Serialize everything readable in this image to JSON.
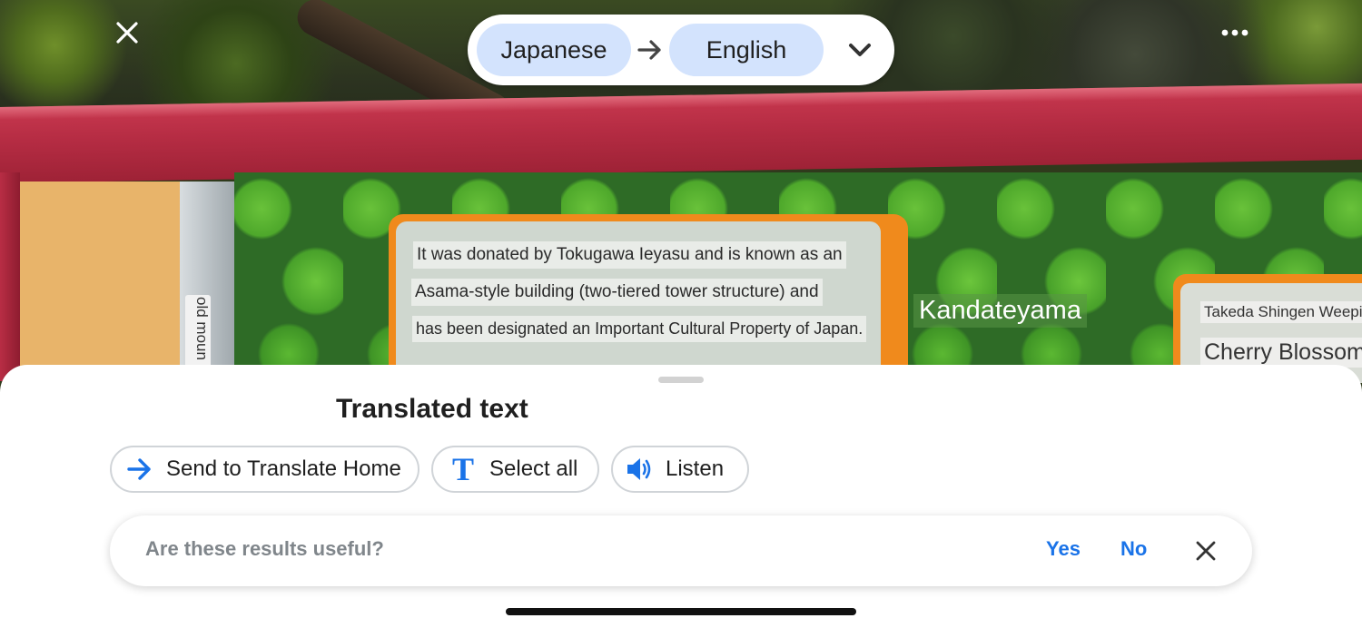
{
  "header": {
    "source_language": "Japanese",
    "target_language": "English"
  },
  "scene": {
    "vertical_label": "old moun",
    "sign_lines": [
      "It was donated by Tokugawa Ieyasu and is known as an",
      "Asama-style building (two-tiered tower structure) and",
      "has been designated an Important Cultural Property of Japan."
    ],
    "kandateyama": "Kandateyama",
    "right_small": "Takeda Shingen Weeping",
    "right_large": "Cherry Blossom"
  },
  "sheet": {
    "title": "Translated text",
    "actions": {
      "send": "Send to Translate Home",
      "select_all": "Select all",
      "listen": "Listen"
    },
    "feedback": {
      "question": "Are these results useful?",
      "yes": "Yes",
      "no": "No"
    }
  },
  "colors": {
    "accent": "#1a73e8",
    "chip": "#d3e3fd"
  },
  "icons": [
    "close-icon",
    "more-icon",
    "arrow-right-icon",
    "chevron-down-icon",
    "send-arrow-icon",
    "text-select-icon",
    "speaker-icon",
    "dismiss-icon"
  ]
}
